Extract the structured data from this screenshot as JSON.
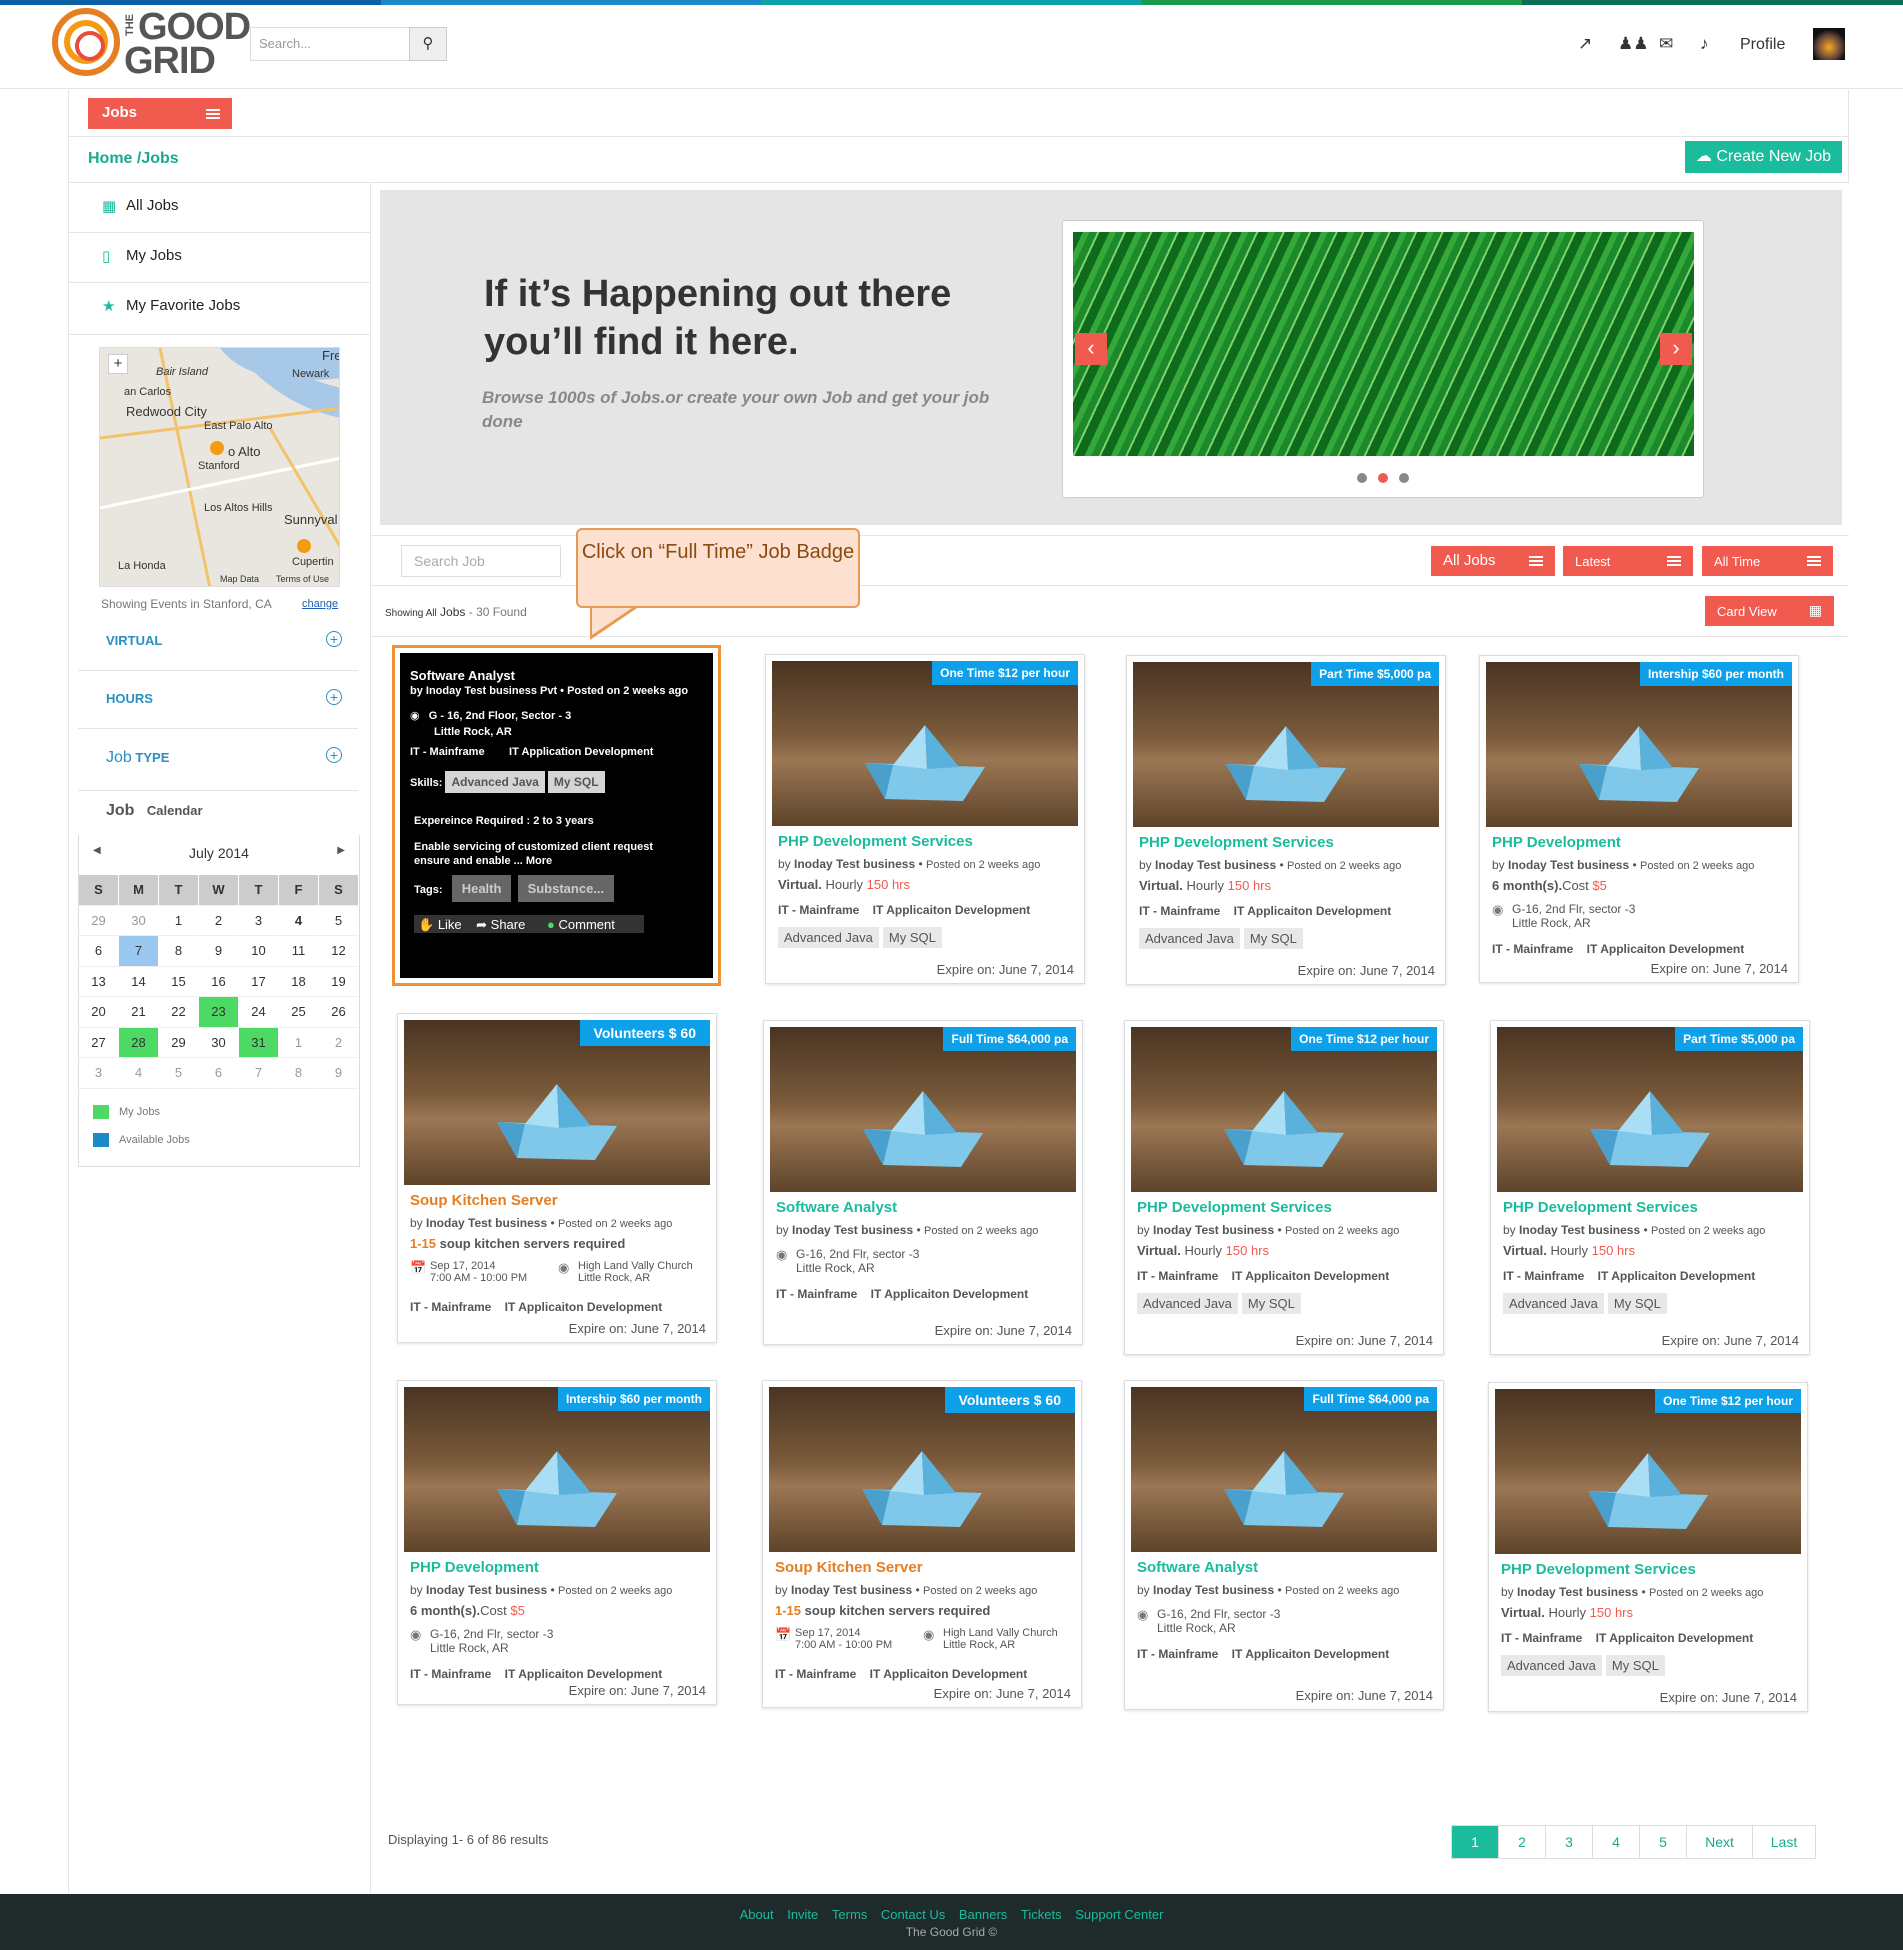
{
  "colors": {
    "accent_red": "#f05a4f",
    "accent_teal": "#1bbc9b",
    "badge_blue": "#0ea1ea",
    "topbar": [
      "#0b5fa5",
      "#1c8ac9",
      "#0aa3a8",
      "#1a9a4a",
      "#0f6e57"
    ]
  },
  "header": {
    "logo_the": "THE",
    "logo_line1": "GOOD",
    "logo_line2": "GRID",
    "search_placeholder": "Search...",
    "profile": "Profile",
    "icons": [
      "external-link-icon",
      "users-icon",
      "mail-icon",
      "bell-icon"
    ]
  },
  "nav": {
    "jobs_tab": "Jobs",
    "breadcrumb": "Home /Jobs",
    "create_button": "Create New Job"
  },
  "sidebar": {
    "items": [
      {
        "label": "All Jobs",
        "icon": "grid-icon"
      },
      {
        "label": "My Jobs",
        "icon": "phone-icon"
      },
      {
        "label": "My Favorite Jobs",
        "icon": "star-icon"
      }
    ],
    "map_labels": [
      "Bair Island",
      "Newark",
      "an Carlos",
      "Redwood City",
      "East Palo Alto",
      "o Alto",
      "Stanford",
      "Los Altos Hills",
      "Sunnyval",
      "La Honda",
      "Cupertin",
      "Map Data",
      "Terms of Use",
      "Fre"
    ],
    "location_text": "Showing Events in Stanford, CA",
    "change": "change",
    "filters": [
      "VIRTUAL",
      "HOURS"
    ],
    "jobtype": {
      "a": "Job",
      "b": "TYPE"
    },
    "calendar_label": {
      "a": "Job",
      "b": "Calendar"
    },
    "calendar": {
      "month": "July 2014",
      "days": [
        "S",
        "M",
        "T",
        "W",
        "T",
        "F",
        "S"
      ],
      "weeks": [
        [
          "29",
          "30",
          "1",
          "2",
          "3",
          "4",
          "5"
        ],
        [
          "6",
          "7",
          "8",
          "9",
          "10",
          "11",
          "12"
        ],
        [
          "13",
          "14",
          "15",
          "16",
          "17",
          "18",
          "19"
        ],
        [
          "20",
          "21",
          "22",
          "23",
          "24",
          "25",
          "26"
        ],
        [
          "27",
          "28",
          "29",
          "30",
          "31",
          "1",
          "2"
        ],
        [
          "3",
          "4",
          "5",
          "6",
          "7",
          "8",
          "9"
        ]
      ]
    },
    "legend": {
      "my": "My Jobs",
      "available": "Available Jobs"
    }
  },
  "hero": {
    "line1": "If it’s Happening out there",
    "line2": "you’ll find it here.",
    "sub": "Browse 1000s of Jobs.or create your own Job and get your job done"
  },
  "filters": {
    "search_placeholder": "Search Job",
    "all_jobs": "All Jobs",
    "latest": "Latest",
    "all_time": "All Time",
    "card_view": "Card View",
    "showing_a": "Showing All",
    "showing_b": "Jobs",
    "showing_c": " - 30 Found"
  },
  "callout": {
    "text": "Click on “Full Time” Job Badge"
  },
  "black_card": {
    "title": "Software Analyst",
    "by": "by Inoday Test business Pvt •  Posted on 2 weeks ago",
    "addr1": "G - 16, 2nd Floor, Sector - 3",
    "addr2": "Little Rock, AR",
    "cats": "IT - Mainframe        IT Application Development",
    "skills_label": "Skills:",
    "skills": [
      "Advanced Java",
      "My SQL"
    ],
    "exp": "Expereince Required :  2 to 3 years",
    "desc1": "Enable servicing of customized client request",
    "desc2": "ensure and enable ... More",
    "tags_label": "Tags:",
    "tags": [
      "Health",
      "Substance..."
    ],
    "actions": [
      "Like",
      "Share",
      "Comment"
    ]
  },
  "cards": [
    {
      "badge": "One Time $12 per hour",
      "title": "PHP Development Services",
      "by": "Inoday Test business",
      "posted": "Posted on 2 weeks ago",
      "l1a": "Virtual.",
      "l1b": " Hourly ",
      "l1c": "150 hrs",
      "cats": "IT - Mainframe    IT Applicaiton Development",
      "tags": [
        "Advanced Java",
        "My SQL"
      ],
      "expire": "Expire on: June 7, 2014"
    },
    {
      "badge": "Part Time $5,000 pa",
      "title": "PHP Development Services",
      "by": "Inoday Test business",
      "posted": "Posted on 2 weeks ago",
      "l1a": "Virtual.",
      "l1b": " Hourly ",
      "l1c": "150 hrs",
      "cats": "IT - Mainframe    IT Applicaiton Development",
      "tags": [
        "Advanced Java",
        "My SQL"
      ],
      "expire": "Expire on: June 7, 2014"
    },
    {
      "badge": "Intership $60 per month",
      "title": "PHP Development",
      "by": "Inoday Test business",
      "posted": "Posted on 2 weeks ago",
      "l1a": "6 month(s).",
      "l1b": "Cost ",
      "l1c": "$5",
      "addr1": "G-16, 2nd Flr, sector -3",
      "addr2": "Little Rock, AR",
      "cats": "IT - Mainframe    IT Applicaiton Development",
      "expire": "Expire on: June 7, 2014"
    },
    {
      "badge": "Volunteers  $ 60",
      "title": "Soup Kitchen Server",
      "by": "Inoday Test business",
      "posted": "Posted on 2 weeks ago",
      "l1a": "1-15",
      "l1b": " soup kitchen servers required",
      "date1": "Sep 17, 2014",
      "date2": "7:00 AM - 10:00 PM",
      "addr1": "High Land Vally Church",
      "addr2": "Little Rock, AR",
      "cats": "IT - Mainframe    IT Applicaiton Development",
      "expire": "Expire on: June 7, 2014"
    },
    {
      "badge": "Full Time $64,000 pa",
      "title": "Software Analyst",
      "by": "Inoday Test business",
      "posted": "Posted on 2 weeks ago",
      "addr1": "G-16, 2nd Flr, sector -3",
      "addr2": "Little Rock, AR",
      "cats": "IT - Mainframe    IT Applicaiton Development",
      "expire": "Expire on: June 7, 2014"
    },
    {
      "badge": "One Time $12 per hour",
      "title": "PHP Development Services",
      "by": "Inoday Test business",
      "posted": "Posted on 2 weeks ago",
      "l1a": "Virtual.",
      "l1b": " Hourly ",
      "l1c": "150 hrs",
      "cats": "IT - Mainframe    IT Applicaiton Development",
      "tags": [
        "Advanced Java",
        "My SQL"
      ],
      "expire": "Expire on: June 7, 2014"
    },
    {
      "badge": "Part Time $5,000 pa",
      "title": "PHP Development Services",
      "by": "Inoday Test business",
      "posted": "Posted on 2 weeks ago",
      "l1a": "Virtual.",
      "l1b": " Hourly ",
      "l1c": "150 hrs",
      "cats": "IT - Mainframe    IT Applicaiton Development",
      "tags": [
        "Advanced Java",
        "My SQL"
      ],
      "expire": "Expire on: June 7, 2014"
    },
    {
      "badge": "Intership $60 per month",
      "title": "PHP Development",
      "by": "Inoday Test business",
      "posted": "Posted on 2 weeks ago",
      "l1a": "6 month(s).",
      "l1b": "Cost ",
      "l1c": "$5",
      "addr1": "G-16, 2nd Flr, sector -3",
      "addr2": "Little Rock, AR",
      "cats": "IT - Mainframe    IT Applicaiton Development",
      "expire": "Expire on: June 7, 2014"
    },
    {
      "badge": "Volunteers  $ 60",
      "title": "Soup Kitchen Server",
      "by": "Inoday Test business",
      "posted": "Posted on 2 weeks ago",
      "l1a": "1-15",
      "l1b": " soup kitchen servers required",
      "date1": "Sep 17, 2014",
      "date2": "7:00 AM - 10:00 PM",
      "addr1": "High Land Vally Church",
      "addr2": "Little Rock, AR",
      "cats": "IT - Mainframe    IT Applicaiton Development",
      "expire": "Expire on: June 7, 2014"
    },
    {
      "badge": "Full Time $64,000 pa",
      "title": "Software Analyst",
      "by": "Inoday Test business",
      "posted": "Posted on 2 weeks ago",
      "addr1": "G-16, 2nd Flr, sector -3",
      "addr2": "Little Rock, AR",
      "cats": "IT - Mainframe    IT Applicaiton Development",
      "expire": "Expire on: June 7, 2014"
    },
    {
      "badge": "One Time $12 per hour",
      "title": "PHP Development Services",
      "by": "Inoday Test business",
      "posted": "Posted on 2 weeks ago",
      "l1a": "Virtual.",
      "l1b": " Hourly ",
      "l1c": "150 hrs",
      "cats": "IT - Mainframe    IT Applicaiton Development",
      "tags": [
        "Advanced Java",
        "My SQL"
      ],
      "expire": "Expire on: June 7, 2014"
    }
  ],
  "pagination": {
    "displaying": "Displaying 1- 6 of 86 results",
    "pages": [
      "1",
      "2",
      "3",
      "4",
      "5",
      "Next",
      "Last"
    ]
  },
  "footer": {
    "links": [
      "About",
      "Invite",
      "Terms",
      "Contact Us",
      "Banners",
      "Tickets",
      "Support Center"
    ],
    "copy": "The Good Grid ©"
  }
}
